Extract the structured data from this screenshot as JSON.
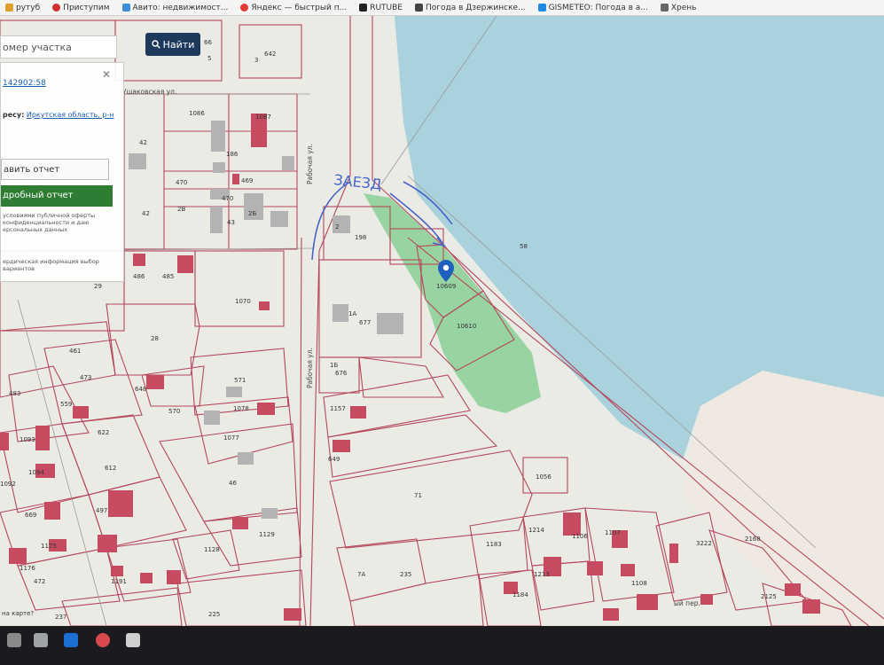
{
  "bookmarks": [
    {
      "label": "рутуб",
      "color": "#e0a030"
    },
    {
      "label": "Приступим",
      "color": "#d32f2f"
    },
    {
      "label": "Авито: недвижимост...",
      "color": "#3a8fd8"
    },
    {
      "label": "Яндекс — быстрый п...",
      "color": "#e53935"
    },
    {
      "label": "RUTUBE",
      "color": "#222222"
    },
    {
      "label": "Погода в Дзержинске...",
      "color": "#444444"
    },
    {
      "label": "GISMETEO: Погода в а...",
      "color": "#1e88e5"
    },
    {
      "label": "Хрень",
      "color": "#666666"
    }
  ],
  "search": {
    "placeholder": "омер участка",
    "button_label": "Найти",
    "button_icon": "search-icon"
  },
  "info_card": {
    "cadastral": "142902:58",
    "address_label": "ресу:",
    "address_value": "Иркутская область, р-н",
    "report_button": "авить отчет",
    "detailed_button": "дробный отчет",
    "terms_text": "условиями публичной оферты конфиденциальности и даю ерсональных данных",
    "legal_text": "ердическая информация выбор вариантов"
  },
  "annotation": {
    "text": "ЗАЕЗД"
  },
  "marker": {
    "label": "10609",
    "icon": "map-pin-icon"
  },
  "streets": {
    "ushakovskaya": "Ушаковская ул.",
    "rabochaya_1": "Рабочая ул.",
    "rabochaya_2": "Рабочая ул.",
    "lane": "ый пер."
  },
  "colors": {
    "water": "#a9d2dd",
    "parcel_highlight": "#8fd09a",
    "boundary": "#b5475a",
    "building": "#c64b61"
  },
  "labels": {
    "p221": "221",
    "p66": "66",
    "p5": "5",
    "p642": "642",
    "p3": "3",
    "p1086": "1086",
    "p1087": "1087",
    "p42a": "42",
    "p186": "186",
    "p470a": "470",
    "p469": "469",
    "p470b": "470",
    "p2b": "2В",
    "p2b2": "2Б",
    "p42b": "42",
    "p43": "43",
    "p2": "2",
    "p198": "198",
    "p58": "58",
    "p10610": "10610",
    "p1a": "1А",
    "p677": "677",
    "p1b": "1Б",
    "p676": "676",
    "p486": "486",
    "p485": "485",
    "p29": "29",
    "p1070": "1070",
    "p28": "28",
    "p461": "461",
    "p473": "473",
    "p483": "483",
    "p559": "559",
    "p648": "648",
    "p571": "571",
    "p570": "570",
    "p1078": "1078",
    "p1077": "1077",
    "p1157": "1157",
    "p1093": "1093",
    "p622": "622",
    "p612": "612",
    "p1094": "1094",
    "p1092": "1092",
    "p649": "649",
    "p46": "46",
    "p71": "71",
    "p1056": "1056",
    "p497": "497",
    "p669": "669",
    "p1129": "1129",
    "p1128": "1128",
    "p1183": "1183",
    "p1214": "1214",
    "p1106": "1106",
    "p1107": "1107",
    "p3222": "3222",
    "p2168": "2168",
    "p1176": "1176",
    "p1175": "1175",
    "p472": "472",
    "p1191": "1191",
    "p1213": "1213",
    "p1184": "1184",
    "p1108": "1108",
    "p7a": "7А",
    "p235": "235",
    "p225": "225",
    "p2125": "2125",
    "p237": "237",
    "p_bottom": "на карте?"
  }
}
